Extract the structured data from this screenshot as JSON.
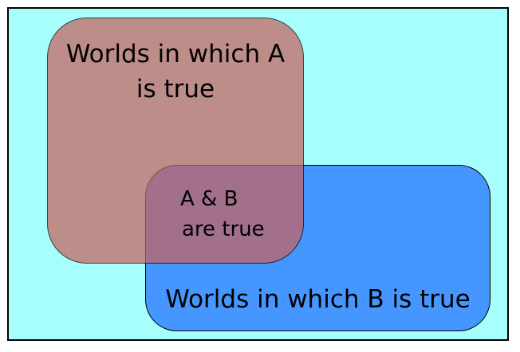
{
  "colors": {
    "background": "#a6fffd",
    "region_a": "#c6625f",
    "region_b": "#4696ff",
    "overlap_blend": "#b15a87",
    "stroke": "#000000"
  },
  "labels": {
    "region_a_line1": "Worlds in which A",
    "region_a_line2": "is true",
    "overlap_line1": "A & B",
    "overlap_line2": "are true",
    "region_b": "Worlds in which B is true"
  }
}
